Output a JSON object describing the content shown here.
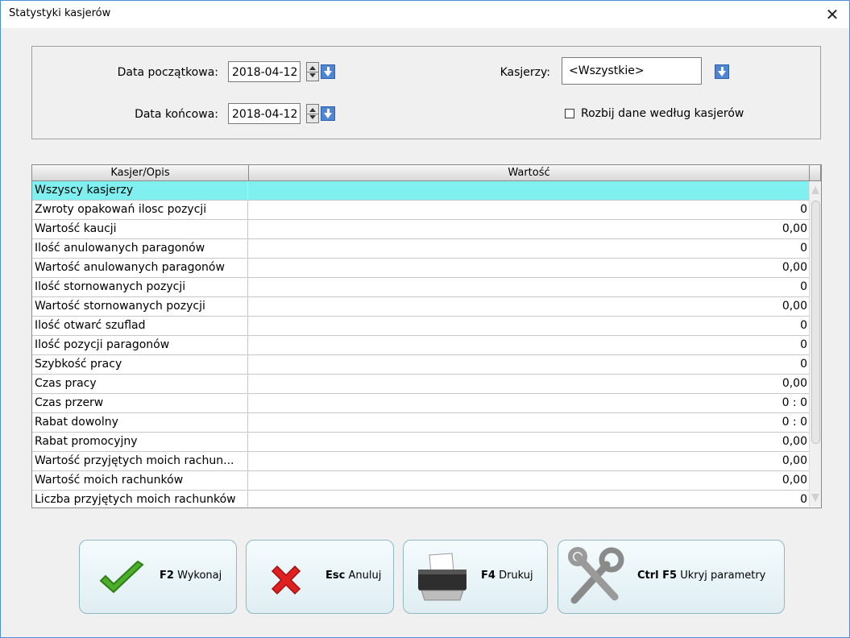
{
  "window": {
    "title": "Statystyki kasjerów",
    "close_symbol": "✕"
  },
  "params": {
    "date_start_label": "Data początkowa:",
    "date_start_value": "2018-04-12",
    "date_end_label": "Data końcowa:",
    "date_end_value": "2018-04-12",
    "cashiers_label": "Kasjerzy:",
    "cashiers_value": "<Wszystkie>",
    "split_label": "Rozbij dane według kasjerów",
    "split_checked": false
  },
  "grid": {
    "columns": [
      "Kasjer/Opis",
      "Wartość"
    ],
    "rows": [
      {
        "label": "Wszyscy kasjerzy",
        "value": ""
      },
      {
        "label": "Zwroty opakowań ilosc pozycji",
        "value": "0"
      },
      {
        "label": "Wartość kaucji",
        "value": "0,00"
      },
      {
        "label": "Ilość anulowanych paragonów",
        "value": "0"
      },
      {
        "label": "Wartość anulowanych paragonów",
        "value": "0,00"
      },
      {
        "label": "Ilość stornowanych pozycji",
        "value": "0"
      },
      {
        "label": "Wartość stornowanych pozycji",
        "value": "0,00"
      },
      {
        "label": "Ilość otwarć szuflad",
        "value": "0"
      },
      {
        "label": "Ilość pozycji paragonów",
        "value": "0"
      },
      {
        "label": "Szybkość pracy",
        "value": "0"
      },
      {
        "label": "Czas pracy",
        "value": "0,00"
      },
      {
        "label": "Czas przerw",
        "value": "0 : 0"
      },
      {
        "label": "Rabat dowolny",
        "value": "0 : 0"
      },
      {
        "label": "Rabat promocyjny",
        "value": "0,00"
      },
      {
        "label": "Wartość przyjętych moich rachun...",
        "value": "0,00"
      },
      {
        "label": "Wartość moich rachunków",
        "value": "0,00"
      },
      {
        "label": "Liczba przyjętych moich rachunków",
        "value": "0"
      }
    ]
  },
  "buttons": {
    "execute": {
      "key": "F2",
      "label": "Wykonaj"
    },
    "cancel": {
      "key": "Esc",
      "label": "Anuluj"
    },
    "print": {
      "key": "F4",
      "label": "Drukuj"
    },
    "hide": {
      "key": "Ctrl F5",
      "label": "Ukryj parametry"
    }
  }
}
